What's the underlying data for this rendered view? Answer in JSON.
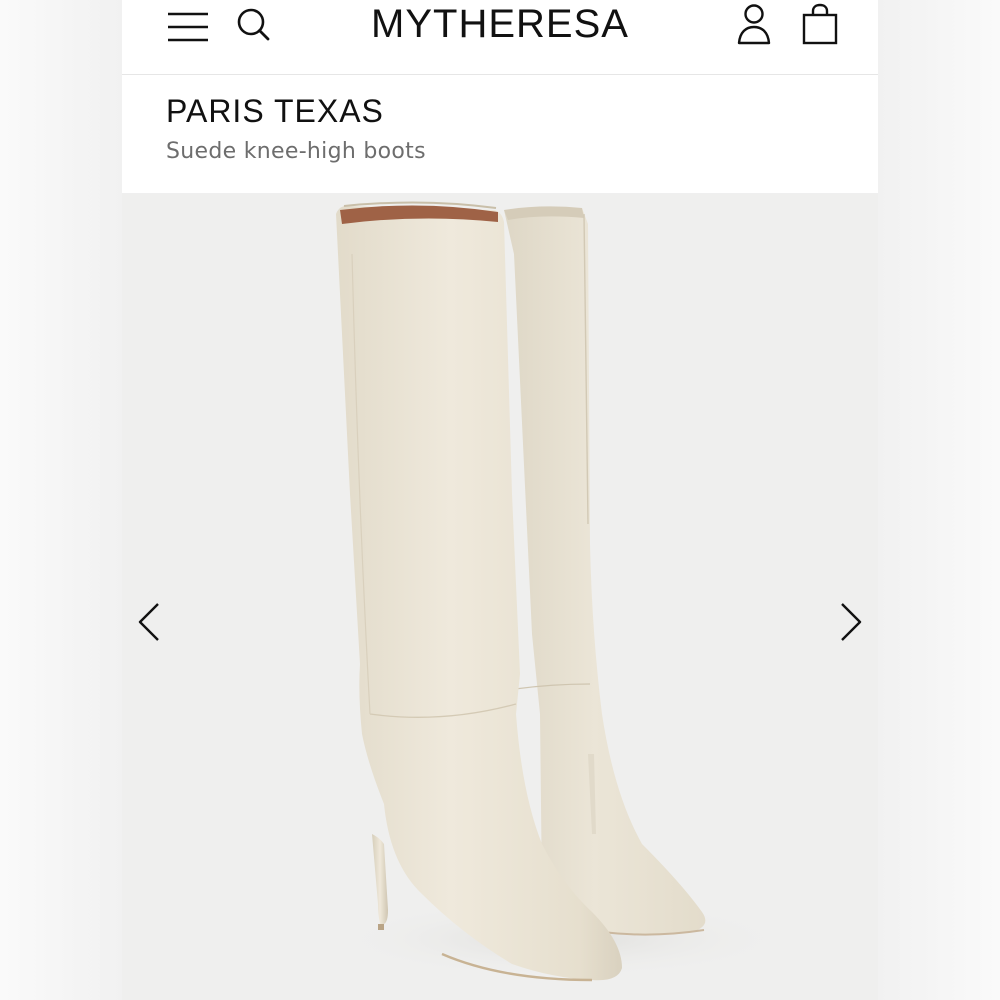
{
  "header": {
    "brand": "MYTHERESA",
    "icons": [
      "menu-icon",
      "search-icon",
      "account-icon",
      "shopping-bag-icon"
    ]
  },
  "product": {
    "designer": "PARIS TEXAS",
    "name": "Suede knee-high boots"
  },
  "gallery": {
    "prev_icon": "chevron-left-icon",
    "next_icon": "chevron-right-icon"
  },
  "colors": {
    "background": "#efefef",
    "boot_suede": "#eae4d6",
    "boot_lining": "#a4684c",
    "text_primary": "#111111",
    "text_secondary": "#6d6d6d"
  }
}
